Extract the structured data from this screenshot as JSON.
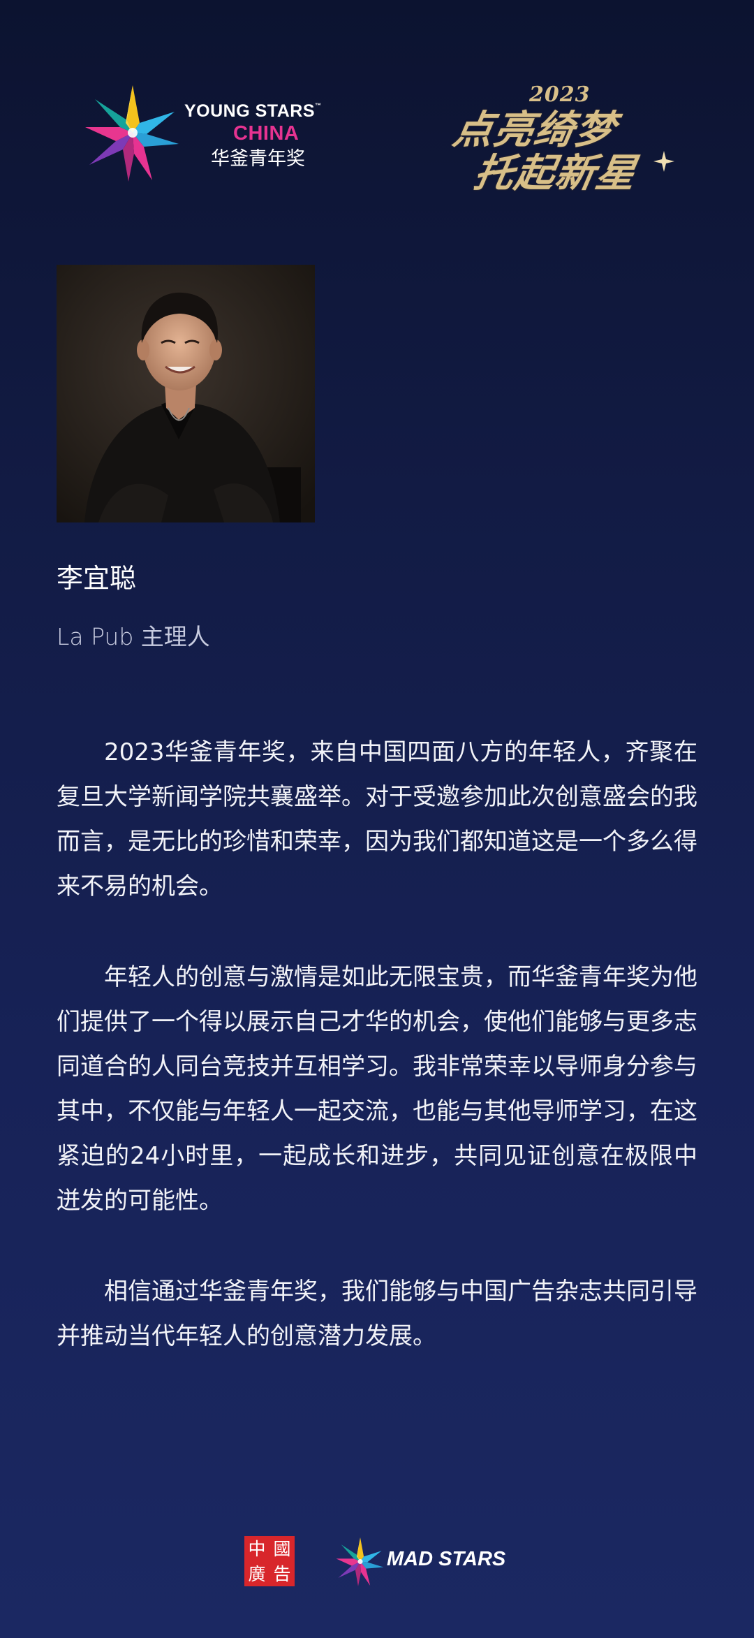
{
  "header": {
    "brand_logo": {
      "line1": "YOUNG STARS",
      "trademark": "™",
      "line2": "CHINA",
      "line3": "华釜青年奖"
    },
    "campaign_logo": {
      "year": "2023",
      "line1": "点亮绮梦",
      "line2": "托起新星"
    }
  },
  "profile": {
    "name": "李宜聪",
    "title": "La Pub 主理人"
  },
  "article": {
    "paragraphs": [
      "2023华釜青年奖，来自中国四面八方的年轻人，齐聚在复旦大学新闻学院共襄盛举。对于受邀参加此次创意盛会的我而言，是无比的珍惜和荣幸，因为我们都知道这是一个多么得来不易的机会。",
      "年轻人的创意与激情是如此无限宝贵，而华釜青年奖为他们提供了一个得以展示自己才华的机会，使他们能够与更多志同道合的人同台竞技并互相学习。我非常荣幸以导师身分参与其中，不仅能与年轻人一起交流，也能与其他导师学习，在这紧迫的24小时里，一起成长和进步，共同见证创意在极限中迸发的可能性。",
      "相信通过华釜青年奖，我们能够与中国广告杂志共同引导并推动当代年轻人的创意潜力发展。"
    ]
  },
  "footer": {
    "china_advertising_logo": {
      "chars": [
        "中",
        "國",
        "廣",
        "告"
      ]
    },
    "madstars_logo": {
      "text": "MAD STARS"
    }
  },
  "colors": {
    "background_top": "#0c1330",
    "background_bottom": "#1b2862",
    "brand_pink": "#e63391",
    "campaign_gold": "#d8bf88",
    "china_advertising_red": "#d8262b",
    "subtitle_gray": "#c8cce0"
  }
}
